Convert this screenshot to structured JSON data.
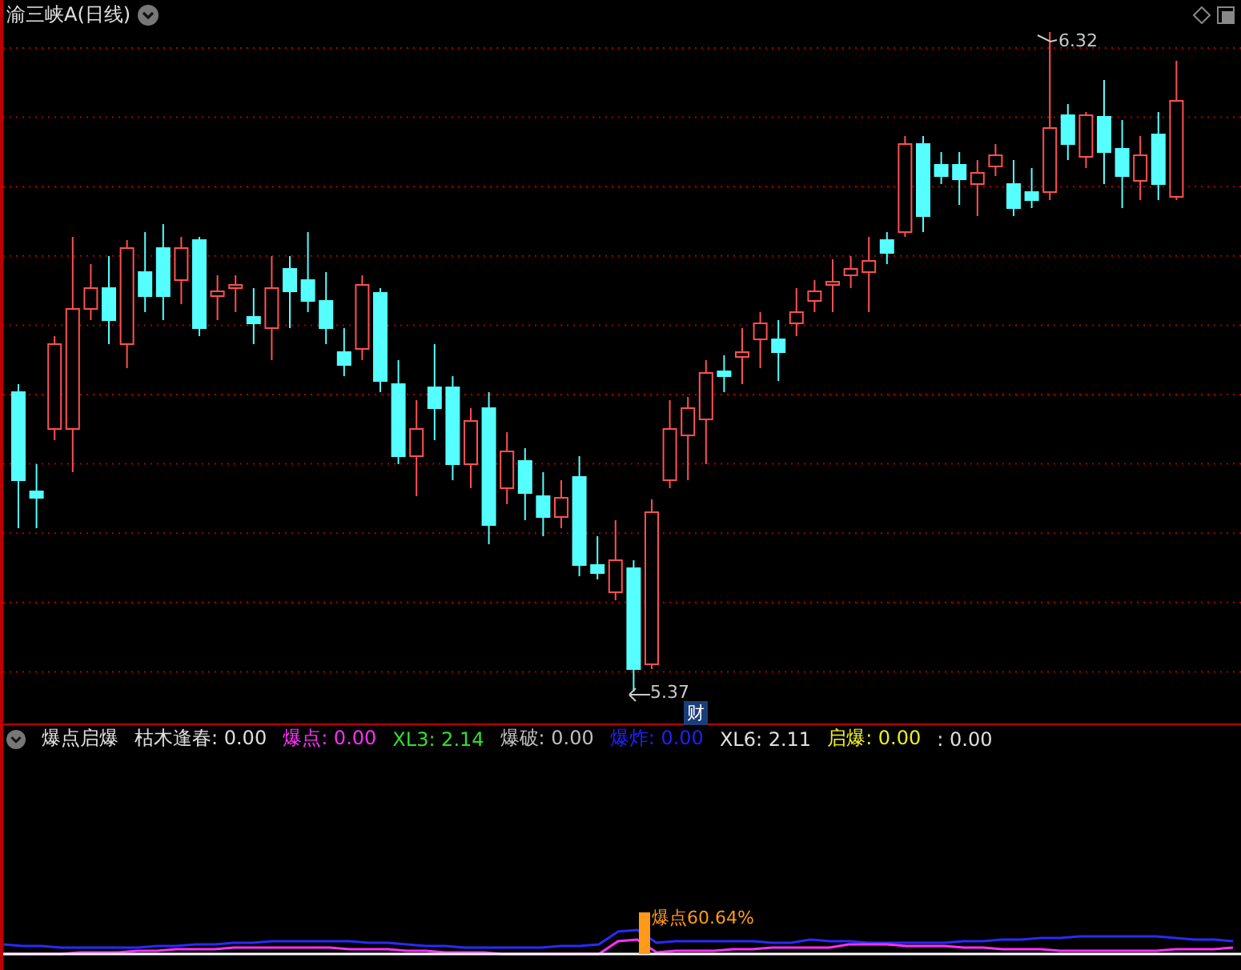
{
  "header": {
    "title": "渝三峡A(日线)"
  },
  "price_chart": {
    "high_label": "6.32",
    "low_label": "5.37",
    "badge": "财"
  },
  "indicator": {
    "name": "爆点启爆",
    "items": [
      {
        "text": "枯木逢春: 0.00",
        "color": "#e0e0e0"
      },
      {
        "text": "爆点: 0.00",
        "color": "#ff30ff"
      },
      {
        "text": "XL3: 2.14",
        "color": "#30e030"
      },
      {
        "text": "爆破: 0.00",
        "color": "#c0c0c0"
      },
      {
        "text": "爆炸: 0.00",
        "color": "#2020ff"
      },
      {
        "text": "XL6: 2.11",
        "color": "#e0e0e0"
      },
      {
        "text": "启爆: 0.00",
        "color": "#f0f020"
      },
      {
        "text": ": 0.00",
        "color": "#e0e0e0"
      }
    ]
  },
  "lower_panel": {
    "signal_label": "爆点60.64%"
  }
}
